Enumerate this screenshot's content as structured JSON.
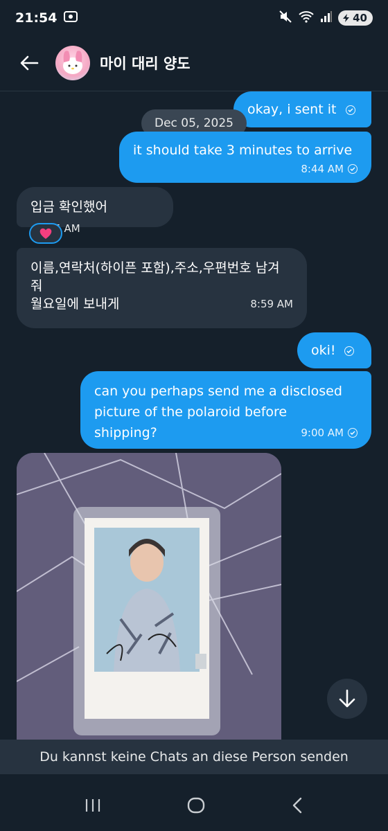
{
  "status_bar": {
    "time": "21:54",
    "battery": "40"
  },
  "header": {
    "contact_name": "마이 대리 양도"
  },
  "conversation": {
    "date_separator": "Dec 05, 2025",
    "messages": [
      {
        "direction": "out",
        "text": "okay, i sent it",
        "time": ""
      },
      {
        "direction": "out",
        "text": "it should take 3 minutes to arrive",
        "time": "8:44 AM"
      },
      {
        "direction": "in",
        "text": "입금 확인했어",
        "time": "8:45 AM",
        "reaction": "❤"
      },
      {
        "direction": "in",
        "lines": [
          "이름,연락처(하이픈 포함),주소,우편번호 남겨",
          "줘",
          "월요일에 보내게"
        ],
        "time": "8:59 AM"
      },
      {
        "direction": "out",
        "text": "oki!",
        "time": ""
      },
      {
        "direction": "out",
        "lines": [
          "can you perhaps send me a disclosed",
          "picture of the polaroid before",
          "shipping?"
        ],
        "time": "9:00 AM"
      }
    ]
  },
  "footer": {
    "notice": "Du kannst keine Chats an diese Person senden"
  },
  "colors": {
    "background": "#15202b",
    "outgoing": "#1d9bf0",
    "incoming": "#273340"
  },
  "icons": [
    "back-arrow-icon",
    "scroll-down-icon",
    "recent-apps-icon",
    "home-icon",
    "nav-back-icon",
    "mute-icon",
    "wifi-icon",
    "signal-icon"
  ]
}
